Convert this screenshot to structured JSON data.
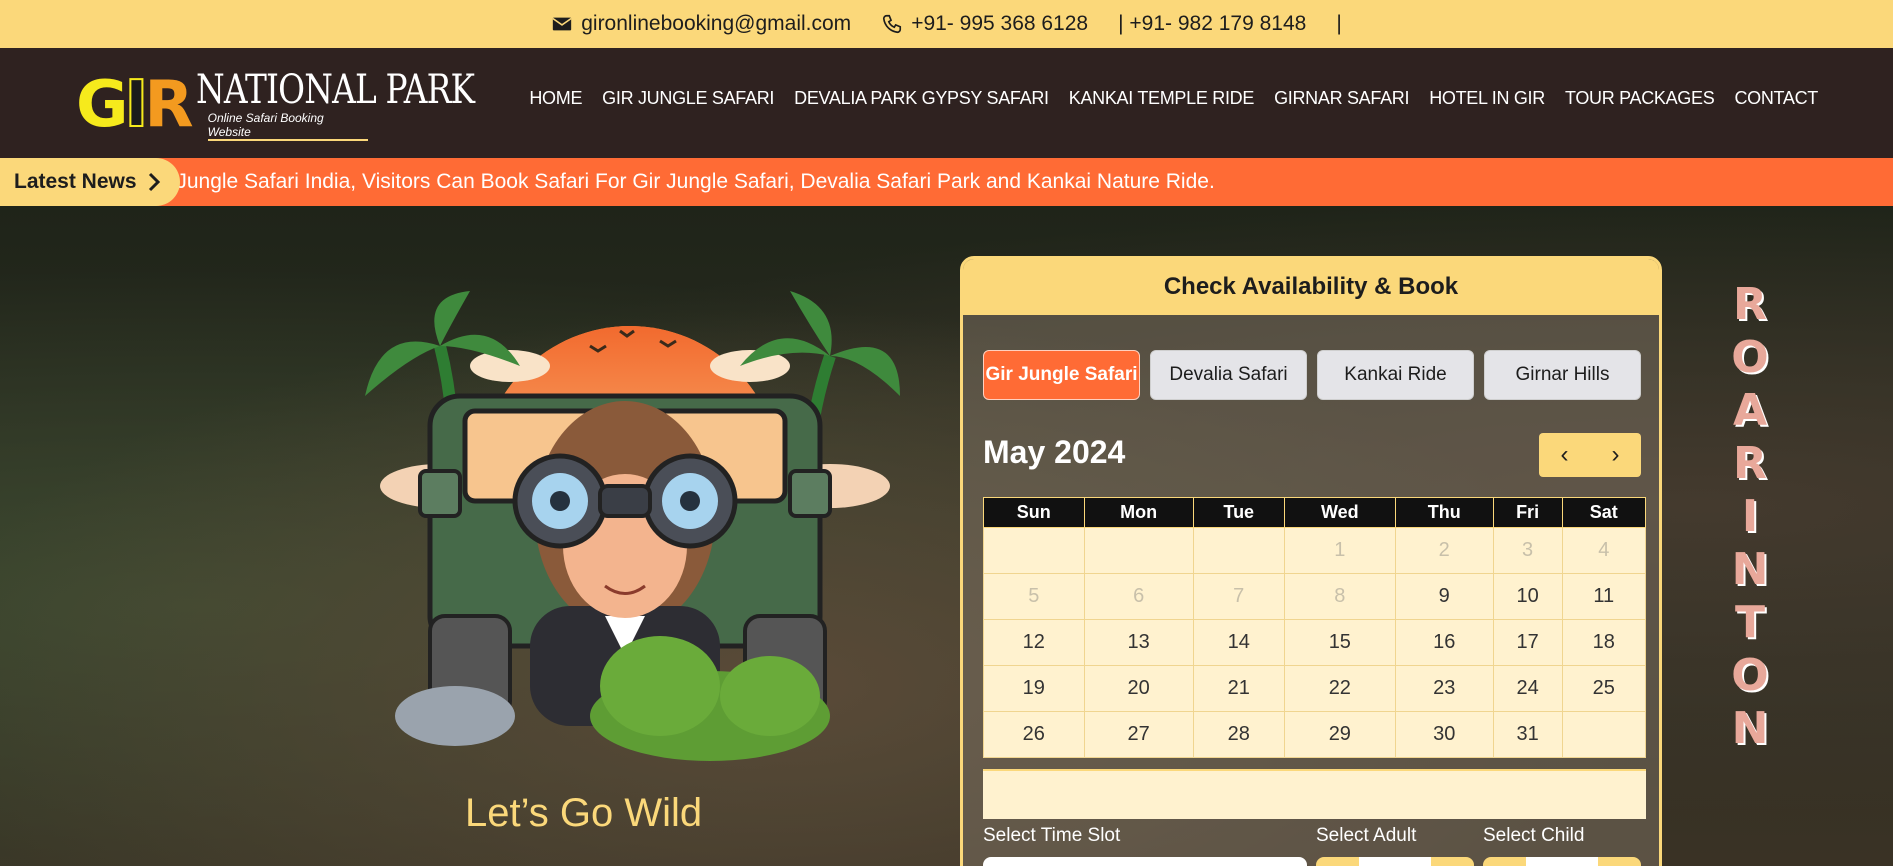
{
  "topbar": {
    "email": "gironlinebooking@gmail.com",
    "phone1": "+91- 995 368 6128",
    "phone2": "| +91- 982 179 8148",
    "separator": "|"
  },
  "logo": {
    "g": "G",
    "i": "I",
    "r": "R",
    "title": "NATIONAL PARK",
    "subtitle": "Online Safari Booking Website"
  },
  "nav": {
    "items": [
      "HOME",
      "GIR JUNGLE SAFARI",
      "DEVALIA PARK GYPSY SAFARI",
      "KANKAI TEMPLE RIDE",
      "GIRNAR SAFARI",
      "HOTEL IN GIR",
      "TOUR PACKAGES",
      "CONTACT"
    ]
  },
  "news": {
    "label": "Latest News",
    "text": "y Jungle Safari India, Visitors Can Book Safari For Gir Jungle Safari, Devalia Safari Park and Kankai Nature Ride."
  },
  "hero": {
    "tagline": "Let’s Go Wild",
    "side_text": [
      "R",
      "O",
      "A",
      "R",
      "I",
      "N",
      "T",
      "O",
      "N"
    ]
  },
  "booking": {
    "title": "Check Availability & Book",
    "tabs": [
      "Gir Jungle Safari",
      "Devalia Safari",
      "Kankai Ride",
      "Girnar Hills"
    ],
    "active_tab": 0,
    "month": "May 2024",
    "weekdays": [
      "Sun",
      "Mon",
      "Tue",
      "Wed",
      "Thu",
      "Fri",
      "Sat"
    ],
    "weeks": [
      [
        "",
        "",
        "",
        "1",
        "2",
        "3",
        "4"
      ],
      [
        "5",
        "6",
        "7",
        "8",
        "9",
        "10",
        "11"
      ],
      [
        "12",
        "13",
        "14",
        "15",
        "16",
        "17",
        "18"
      ],
      [
        "19",
        "20",
        "21",
        "22",
        "23",
        "24",
        "25"
      ],
      [
        "26",
        "27",
        "28",
        "29",
        "30",
        "31",
        ""
      ]
    ],
    "disabled_days": [
      "1",
      "2",
      "3",
      "4",
      "5",
      "6",
      "7",
      "8"
    ],
    "labels": {
      "time_slot": "Select Time Slot",
      "adult": "Select Adult",
      "child": "Select Child"
    }
  },
  "colors": {
    "accent_yellow": "#fbd87a",
    "accent_orange": "#ff6b35",
    "header_dark": "#2f2220"
  },
  "icons": [
    "envelope-icon",
    "phone-icon",
    "chevron-right-icon",
    "chevron-left-icon"
  ]
}
